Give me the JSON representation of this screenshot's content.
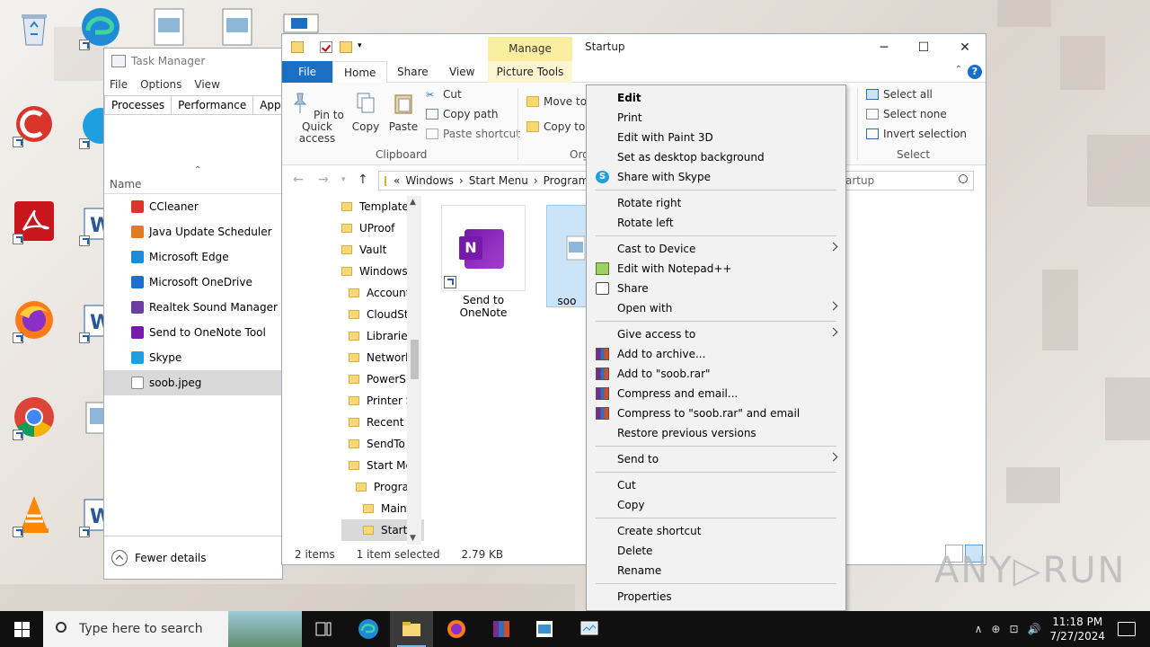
{
  "colors": {
    "accent": "#1a6fc4",
    "manage_tab": "#fbeea0",
    "selection": "#cce4f7",
    "taskbar": "#101010"
  },
  "task_manager": {
    "title": "Task Manager",
    "menu": [
      "File",
      "Options",
      "View"
    ],
    "tabs": [
      "Processes",
      "Performance",
      "App hist"
    ],
    "column_header": "Name",
    "items": [
      {
        "label": "CCleaner",
        "icon": "ccleaner-icon",
        "color": "#d9352b"
      },
      {
        "label": "Java Update Scheduler",
        "icon": "java-icon",
        "color": "#e07b1f"
      },
      {
        "label": "Microsoft Edge",
        "icon": "edge-icon",
        "color": "#1f8bd6"
      },
      {
        "label": "Microsoft OneDrive",
        "icon": "onedrive-icon",
        "color": "#1e6fd0"
      },
      {
        "label": "Realtek Sound Manager",
        "icon": "realtek-icon",
        "color": "#6b3fa0"
      },
      {
        "label": "Send to OneNote Tool",
        "icon": "onenote-icon",
        "color": "#7719aa"
      },
      {
        "label": "Skype",
        "icon": "skype-icon",
        "color": "#1ea0e0"
      },
      {
        "label": "soob.jpeg",
        "icon": "file-icon",
        "color": "#ffffff"
      }
    ],
    "footer": "Fewer details"
  },
  "explorer": {
    "title": "Startup",
    "manage_tab": "Manage",
    "tabs": {
      "file": "File",
      "home": "Home",
      "share": "Share",
      "view": "View",
      "picture_tools": "Picture Tools"
    },
    "window_buttons": {
      "minimize": "─",
      "maximize": "☐",
      "close": "✕"
    },
    "help": "?",
    "ribbon": {
      "pin": "Pin to Quick access",
      "copy": "Copy",
      "paste": "Paste",
      "cut": "Cut",
      "copy_path": "Copy path",
      "paste_shortcut": "Paste shortcut",
      "clipboard_group": "Clipboard",
      "move_to": "Move to",
      "copy_to": "Copy to",
      "organize_group": "Org",
      "select_all": "Select all",
      "select_none": "Select none",
      "invert_selection": "Invert selection",
      "select_group": "Select"
    },
    "address": [
      "«",
      "Windows",
      "›",
      "Start Menu",
      "›",
      "Program"
    ],
    "search_placeholder": "artup",
    "nav_items": [
      {
        "label": "Templates",
        "indent": 0
      },
      {
        "label": "UProof",
        "indent": 0
      },
      {
        "label": "Vault",
        "indent": 0
      },
      {
        "label": "Windows",
        "indent": 0
      },
      {
        "label": "Account",
        "indent": 1
      },
      {
        "label": "CloudSto",
        "indent": 1
      },
      {
        "label": "Libraries",
        "indent": 1
      },
      {
        "label": "Network",
        "indent": 1
      },
      {
        "label": "PowerSh",
        "indent": 1
      },
      {
        "label": "Printer S",
        "indent": 1
      },
      {
        "label": "Recent It",
        "indent": 1
      },
      {
        "label": "SendTo",
        "indent": 1
      },
      {
        "label": "Start Mer",
        "indent": 1
      },
      {
        "label": "Program",
        "indent": 2
      },
      {
        "label": "Maint",
        "indent": 3
      },
      {
        "label": "Startu",
        "indent": 3
      }
    ],
    "files": [
      {
        "label": "Send to OneNote",
        "selected": false
      },
      {
        "label": "soo",
        "selected": true
      }
    ],
    "status": {
      "items": "2 items",
      "selected": "1 item selected",
      "size": "2.79 KB"
    }
  },
  "context_menu": {
    "groups": [
      [
        {
          "label": "Edit",
          "bold": true
        },
        {
          "label": "Print"
        },
        {
          "label": "Edit with Paint 3D"
        },
        {
          "label": "Set as desktop background"
        },
        {
          "label": "Share with Skype",
          "icon": "skype-icon"
        }
      ],
      [
        {
          "label": "Rotate right"
        },
        {
          "label": "Rotate left"
        }
      ],
      [
        {
          "label": "Cast to Device",
          "submenu": true
        },
        {
          "label": "Edit with Notepad++",
          "icon": "notepad-plus-plus-icon"
        },
        {
          "label": "Share",
          "icon": "share-icon"
        },
        {
          "label": "Open with",
          "submenu": true
        }
      ],
      [
        {
          "label": "Give access to",
          "submenu": true
        },
        {
          "label": "Add to archive...",
          "icon": "winrar-icon"
        },
        {
          "label": "Add to \"soob.rar\"",
          "icon": "winrar-icon"
        },
        {
          "label": "Compress and email...",
          "icon": "winrar-icon"
        },
        {
          "label": "Compress to \"soob.rar\" and email",
          "icon": "winrar-icon"
        },
        {
          "label": "Restore previous versions"
        }
      ],
      [
        {
          "label": "Send to",
          "submenu": true
        }
      ],
      [
        {
          "label": "Cut"
        },
        {
          "label": "Copy"
        }
      ],
      [
        {
          "label": "Create shortcut"
        },
        {
          "label": "Delete"
        },
        {
          "label": "Rename"
        }
      ],
      [
        {
          "label": "Properties"
        }
      ]
    ]
  },
  "taskbar": {
    "search_placeholder": "Type here to search",
    "time": "11:18 PM",
    "date": "7/27/2024",
    "tray_glyphs": [
      "∧",
      "⊕",
      "⊡",
      "🔊"
    ]
  },
  "watermark": "ANY▷RUN"
}
